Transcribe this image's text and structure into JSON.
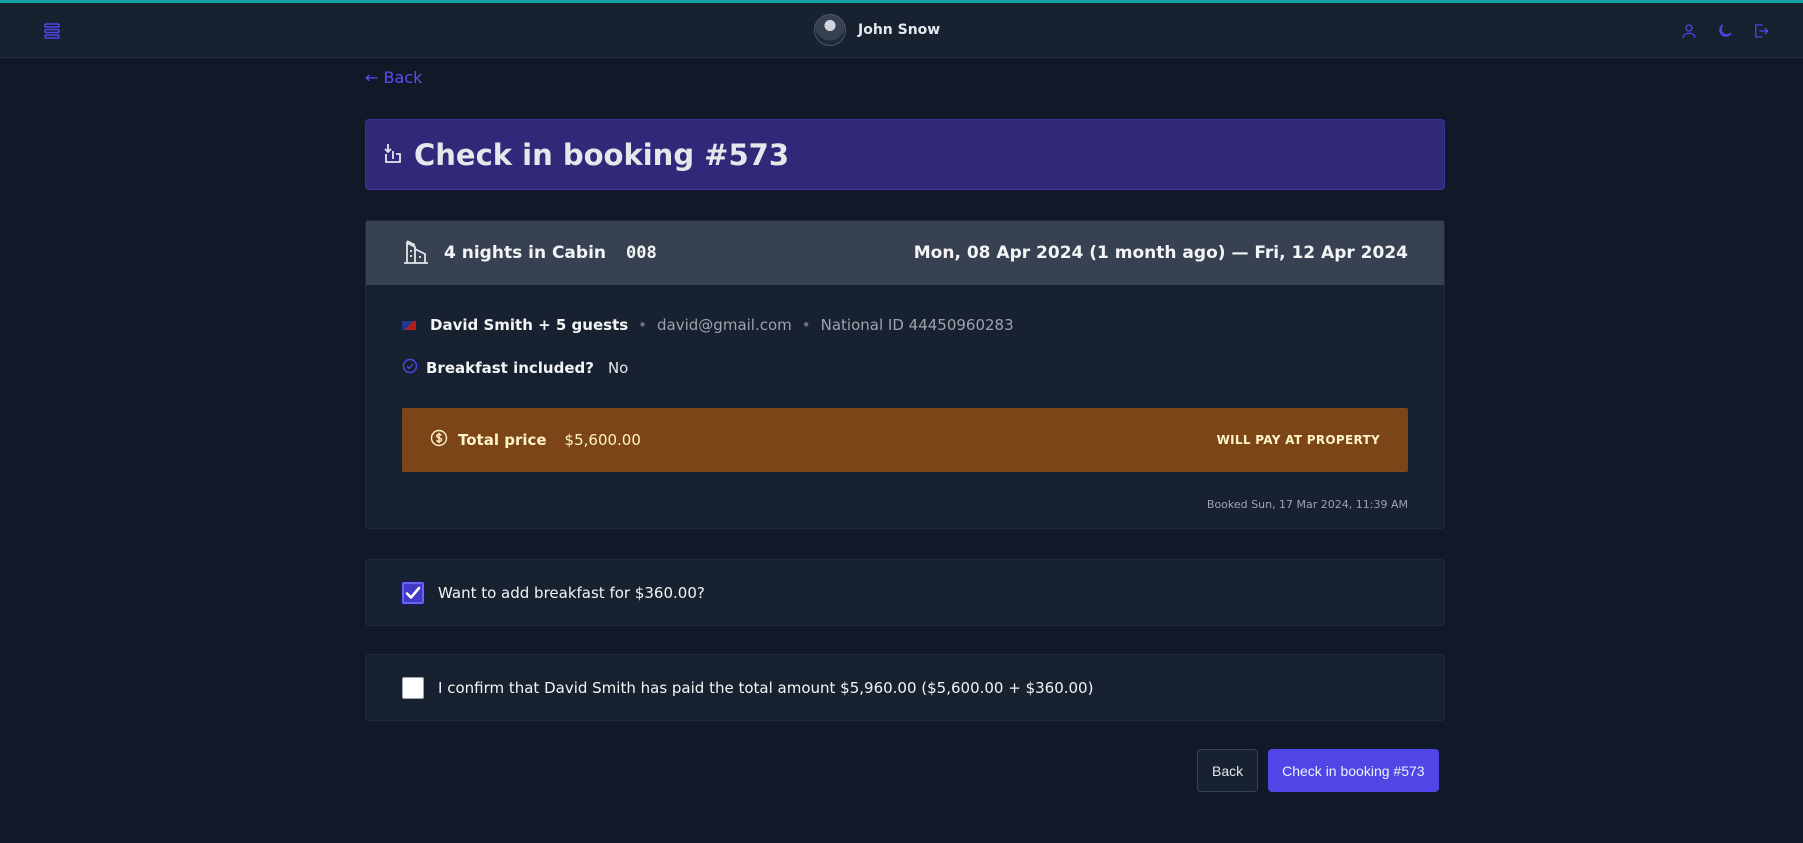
{
  "header": {
    "user_name": "John Snow"
  },
  "nav": {
    "back_link": "← Back"
  },
  "title": {
    "text": "Check in booking #573"
  },
  "booking": {
    "nights_text": "4 nights in Cabin",
    "cabin_code": "008",
    "dates": "Mon, 08 Apr 2024 (1 month ago) — Fri, 12 Apr 2024",
    "guest_name": "David Smith + 5 guests",
    "guest_email": "david@gmail.com",
    "guest_national_id": "National ID 44450960283",
    "separator": "•",
    "breakfast_question": "Breakfast included?",
    "breakfast_value": "No",
    "price_label": "Total price",
    "price_value": "$5,600.00",
    "payment_status": "WILL PAY AT PROPERTY",
    "booked_at": "Booked Sun, 17 Mar 2024, 11:39 AM"
  },
  "options": {
    "add_breakfast_label": "Want to add breakfast for $360.00?",
    "add_breakfast_checked": true,
    "confirm_paid_label": "I confirm that David Smith has paid the total amount $5,960.00 ($5,600.00 + $360.00)",
    "confirm_paid_checked": false
  },
  "actions": {
    "back_label": "Back",
    "checkin_label": "Check in booking #573"
  },
  "colors": {
    "accent": "#4f46e5",
    "title_bg": "#312879",
    "price_bg": "#7b4518",
    "top_line": "#14a3a3"
  }
}
